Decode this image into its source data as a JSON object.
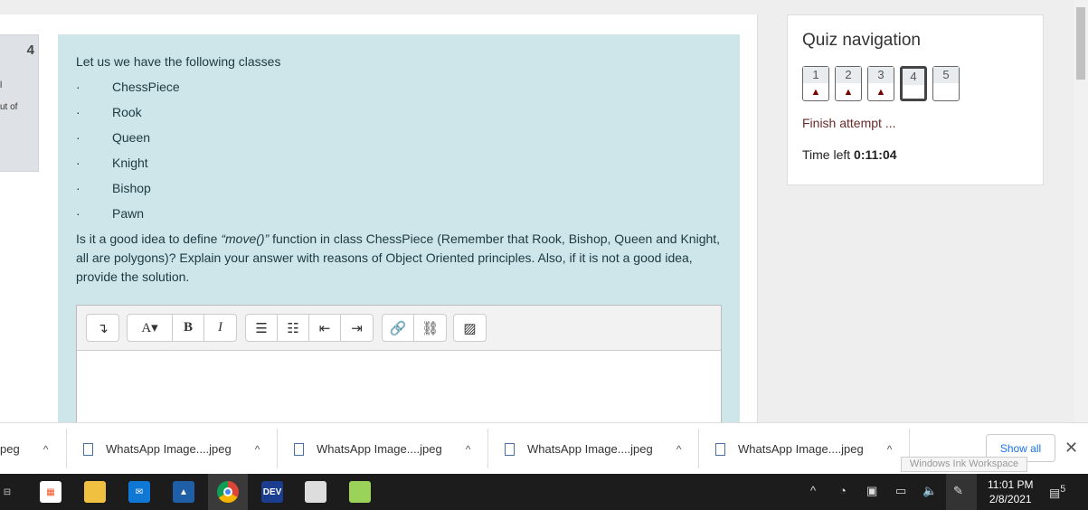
{
  "info": {
    "number": "4",
    "line1": "l",
    "line2": "ut of"
  },
  "question": {
    "intro": "Let us we have the following classes",
    "bullet": "·",
    "classes": [
      "ChessPiece",
      "Rook",
      "Queen",
      "Knight",
      "Bishop",
      "Pawn"
    ],
    "text_before": "Is it a good idea to define ",
    "text_func": "“move()”",
    "text_after": " function in class ChessPiece (Remember that Rook, Bishop, Queen and Knight, all are polygons)? Explain your answer with reasons of Object Oriented principles. Also, if it is not a good idea, provide the solution."
  },
  "editor": {
    "toolbar": {
      "font": "A▾",
      "bold": "B",
      "italic": "I"
    }
  },
  "quiz_nav": {
    "title": "Quiz navigation",
    "buttons": [
      {
        "label": "1",
        "flag": "▲"
      },
      {
        "label": "2",
        "flag": "▲"
      },
      {
        "label": "3",
        "flag": "▲"
      },
      {
        "label": "4",
        "flag": ""
      },
      {
        "label": "5",
        "flag": ""
      }
    ],
    "finish": "Finish attempt ...",
    "time_label": "Time left ",
    "time_value": "0:11:04"
  },
  "downloads": {
    "items": [
      "peg",
      "WhatsApp Image....jpeg",
      "WhatsApp Image....jpeg",
      "WhatsApp Image....jpeg",
      "WhatsApp Image....jpeg"
    ],
    "show_all": "Show all",
    "close": "✕",
    "tooltip": "Windows Ink Workspace"
  },
  "taskbar": {
    "time": "11:01 PM",
    "date": "2/8/2021",
    "notifications": "5",
    "dev_label": "DEV"
  }
}
